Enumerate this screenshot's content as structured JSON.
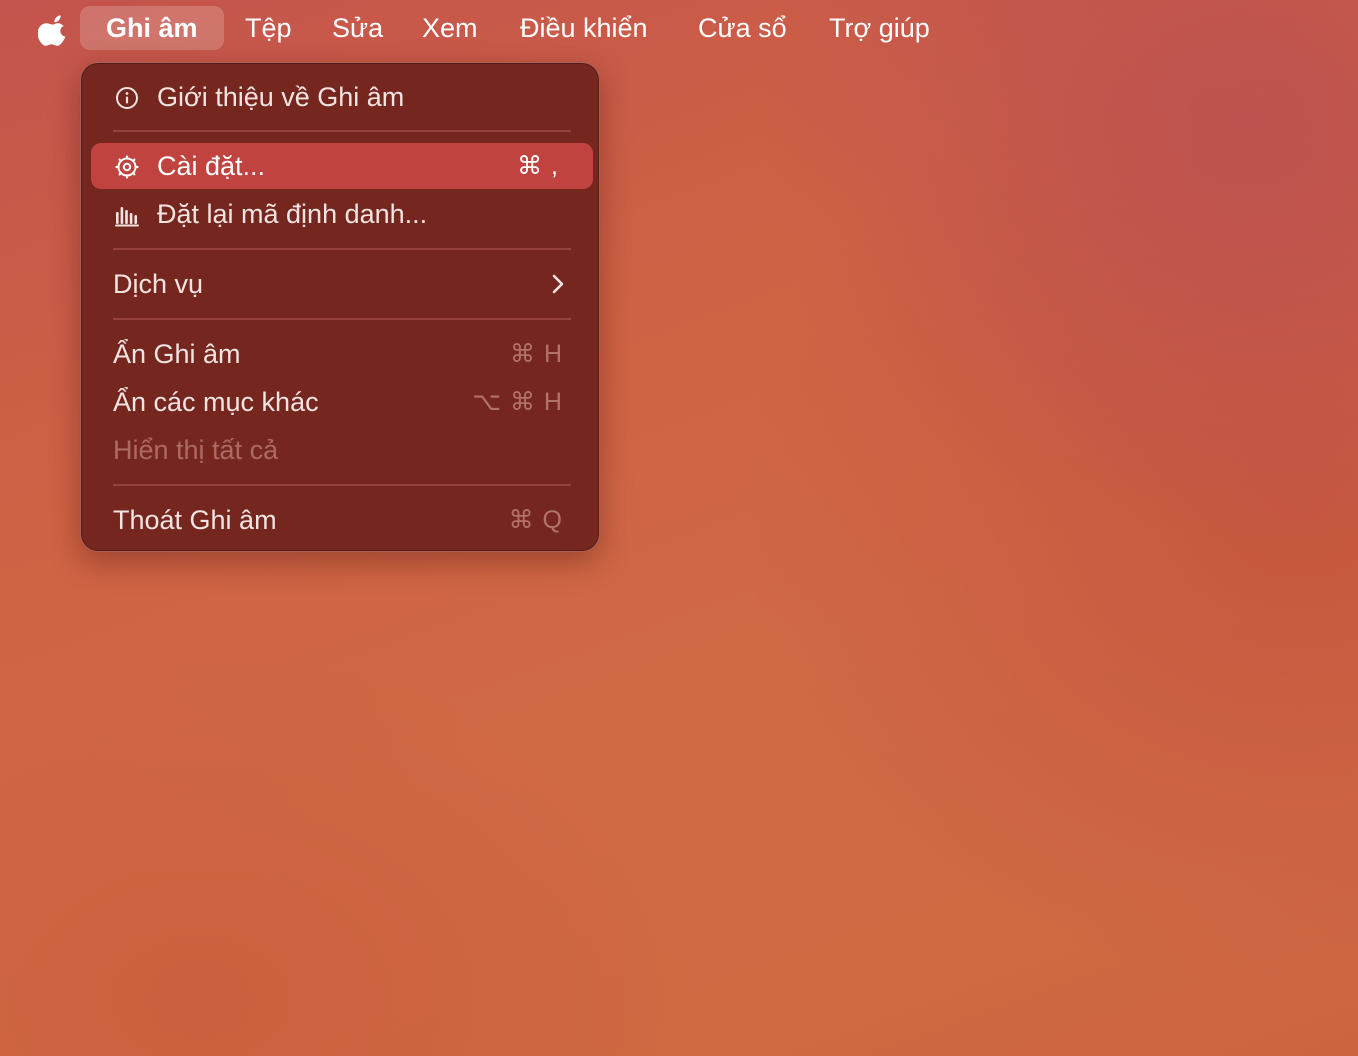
{
  "menubar": {
    "apple_icon": "apple-logo-icon",
    "items": [
      {
        "label": "Ghi âm"
      },
      {
        "label": "Tệp"
      },
      {
        "label": "Sửa"
      },
      {
        "label": "Xem"
      },
      {
        "label": "Điều khiển"
      },
      {
        "label": "Cửa sổ"
      },
      {
        "label": "Trợ giúp"
      }
    ]
  },
  "dropdown": {
    "about": {
      "label": "Giới thiệu về Ghi âm",
      "icon": "info-circle-icon"
    },
    "settings": {
      "label": "Cài đặt...",
      "icon": "gear-icon",
      "shortcut": "⌘ ,"
    },
    "reset": {
      "label": "Đặt lại mã định danh...",
      "icon": "waveform-bars-icon"
    },
    "services": {
      "label": "Dịch vụ",
      "icon": "chevron-right-icon"
    },
    "hide": {
      "label": "Ẩn Ghi âm",
      "shortcut": "⌘ H"
    },
    "hide_others": {
      "label": "Ẩn các mục khác",
      "shortcut": "⌥ ⌘ H"
    },
    "show_all": {
      "label": "Hiển thị tất cả"
    },
    "quit": {
      "label": "Thoát Ghi âm",
      "shortcut": "⌘ Q"
    }
  },
  "colors": {
    "menu_background": "#72241e",
    "highlight": "#c0433f"
  }
}
